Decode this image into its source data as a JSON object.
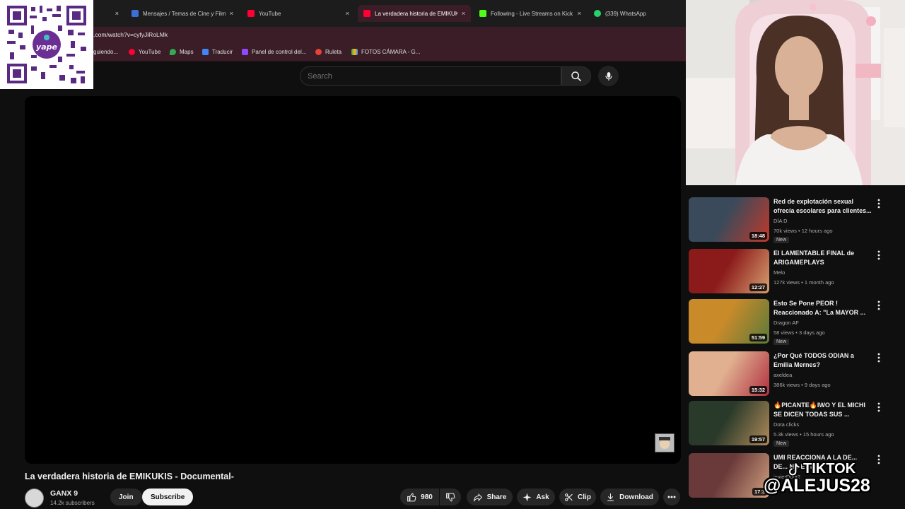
{
  "browser": {
    "tabs": [
      {
        "title": "",
        "active": false,
        "fav": "#888888"
      },
      {
        "title": "Mensajes / Temas de Cine y Filmes",
        "active": false,
        "fav": "#3b6fd8"
      },
      {
        "title": "YouTube",
        "active": false,
        "fav": "#ff0033"
      },
      {
        "title": "La verdadera historia de EMIKUKIS",
        "active": true,
        "fav": "#ff0033"
      },
      {
        "title": "Following - Live Streams on Kick",
        "active": false,
        "fav": "#53fc18"
      },
      {
        "title": "(339) WhatsApp",
        "active": false,
        "fav": "#25d366"
      }
    ],
    "close_glyph": "×",
    "url": ".com/watch?v=cyfyJiRoLMk",
    "bookmarks": [
      {
        "label": "guiendo...",
        "color": "#888888"
      },
      {
        "label": "YouTube",
        "color": "#ff0033"
      },
      {
        "label": "Maps",
        "color": "#34a853"
      },
      {
        "label": "Traducir",
        "color": "#4285f4"
      },
      {
        "label": "Panel de control del...",
        "color": "#9146ff"
      },
      {
        "label": "Ruleta",
        "color": "#ea4335"
      },
      {
        "label": "FOTOS CÁMARA - G...",
        "color": "#fbbc04"
      }
    ]
  },
  "search": {
    "placeholder": "Search"
  },
  "video": {
    "title": "La verdadera historia de EMIKUKIS - Documental-",
    "channel": "GANX 9",
    "subscribers": "14.2k subscribers",
    "join_label": "Join",
    "subscribe_label": "Subscribe",
    "likes": "980",
    "share_label": "Share",
    "ask_label": "Ask",
    "clip_label": "Clip",
    "download_label": "Download"
  },
  "recommendations": [
    {
      "title": "Red de explotación sexual ofrecía escolares para clientes...",
      "channel": "DÍA D",
      "meta": "70k views • 12 hours ago",
      "duration": "18:48",
      "badge": "New",
      "colors": [
        "#3a4a5a",
        "#c0392b"
      ]
    },
    {
      "title": "El LAMENTABLE FINAL de ARIGAMEPLAYS",
      "channel": "Melo",
      "meta": "127k views • 1 month ago",
      "duration": "12:27",
      "badge": "",
      "colors": [
        "#8b1a1a",
        "#d8a070"
      ]
    },
    {
      "title": "Esto Se Pone PEOR ! Reaccionado A: \"La MAYOR ...",
      "channel": "Dragon AF",
      "meta": "58 views • 3 days ago",
      "duration": "51:59",
      "badge": "New",
      "colors": [
        "#c98a2a",
        "#5a7a3a"
      ]
    },
    {
      "title": "¿Por Qué TODOS ODIAN a Emilia Mernes?",
      "channel": "axeldea",
      "meta": "386k views • 9 days ago",
      "duration": "15:32",
      "badge": "",
      "colors": [
        "#e0b090",
        "#b03040"
      ]
    },
    {
      "title": "🔥PICANTE🔥IWO Y EL MICHI SE DICEN TODAS SUS ...",
      "channel": "Dota clicks",
      "meta": "5.3k views • 15 hours ago",
      "duration": "19:57",
      "badge": "New",
      "colors": [
        "#2a3a2a",
        "#b08a5a"
      ]
    },
    {
      "title": "UMI REACCIONA A LA DE... DE... NO EST...",
      "channel": "invierDota2",
      "meta": "",
      "duration": "17:3",
      "badge": "",
      "colors": [
        "#6a3a3a",
        "#d0a080"
      ]
    }
  ],
  "overlay": {
    "tiktok_line1": "TIKTOK",
    "tiktok_line2": "@ALEJUS28",
    "qr_brand": "yape"
  }
}
